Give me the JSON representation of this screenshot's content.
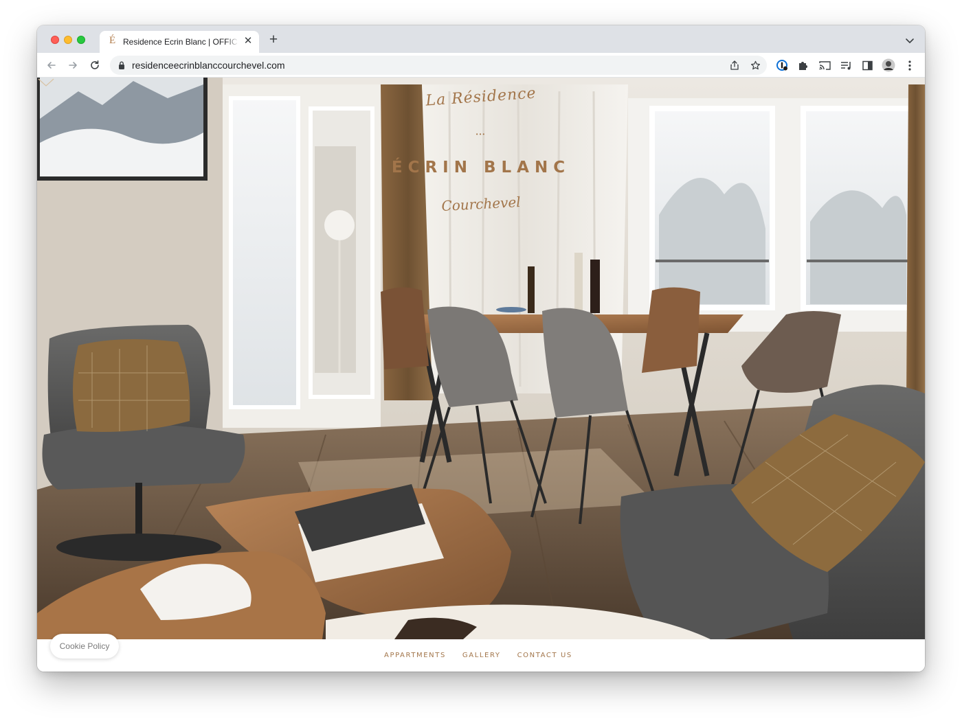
{
  "browser": {
    "tab": {
      "favicon_letter": "É",
      "title": "Residence Ecrin Blanc | OFFICIAL",
      "close_glyph": "✕"
    },
    "new_tab_glyph": "+",
    "address_bar": {
      "url": "residenceecrinblanccourchevel.com"
    },
    "icons": [
      "back-icon",
      "forward-icon",
      "reload-icon",
      "lock-icon",
      "share-icon",
      "bookmark-star-icon",
      "extension-1password-icon",
      "extensions-puzzle-icon",
      "cast-icon",
      "media-queue-icon",
      "side-panel-icon",
      "profile-avatar",
      "more-menu-icon",
      "tab-list-chevron-icon"
    ]
  },
  "hero": {
    "logo": {
      "script_line": "La Résidence",
      "dots": "•••",
      "name": "ÉCRIN BLANC",
      "place": "Courchevel"
    },
    "accent_color": "#a2754a"
  },
  "nav": {
    "links": [
      {
        "label": "APPARTMENTS"
      },
      {
        "label": "GALLERY"
      },
      {
        "label": "CONTACT US"
      }
    ]
  },
  "cookie": {
    "label": "Cookie Policy"
  }
}
